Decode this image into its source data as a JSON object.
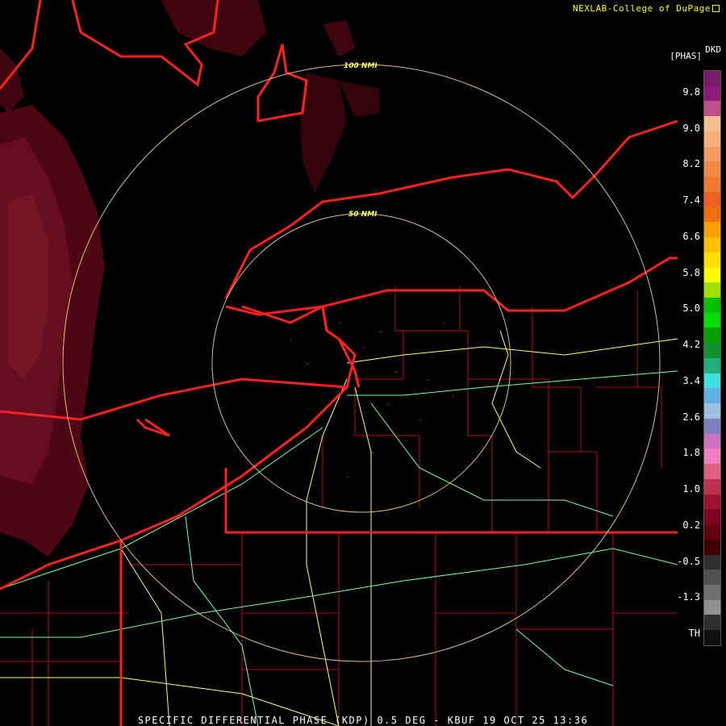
{
  "credit": "NEXLAB-College of DuPage",
  "legend": {
    "unit": "DKD",
    "title": "[PHAS]",
    "ticks": [
      "9.8",
      "9.0",
      "8.2",
      "7.4",
      "6.6",
      "5.8",
      "5.0",
      "4.2",
      "3.4",
      "2.6",
      "1.8",
      "1.0",
      "0.2",
      "-0.5",
      "-1.3",
      "TH"
    ],
    "colors": [
      "#7a1a6a",
      "#8b1a7a",
      "#c0508a",
      "#f5c090",
      "#f7b078",
      "#f59a60",
      "#f48a48",
      "#f37a30",
      "#f06020",
      "#f07010",
      "#ffa000",
      "#ffc000",
      "#ffe000",
      "#ffff00",
      "#a0e000",
      "#00c000",
      "#00e000",
      "#00a000",
      "#109030",
      "#20b080",
      "#40e0e0",
      "#60b0e0",
      "#a0c0e0",
      "#8080c0",
      "#d070c0",
      "#f080c0",
      "#e06080",
      "#c03050",
      "#a01030",
      "#800020",
      "#600010",
      "#400000",
      "#303030",
      "#505050",
      "#707070",
      "#909090",
      "#303030",
      "#101010"
    ]
  },
  "rings": [
    {
      "label": "100 NMI"
    },
    {
      "label": "50 NMI"
    }
  ],
  "footer": "SPECIFIC DIFFERENTIAL PHASE (KDP) 0.5 DEG - KBUF 19 OCT 25 13:36",
  "colors": {
    "state_border": "#ff2020",
    "county_border": "#c01010",
    "highway_yellow": "#ffff80",
    "highway_green": "#80ffa0",
    "echo": "#6a0a20"
  }
}
